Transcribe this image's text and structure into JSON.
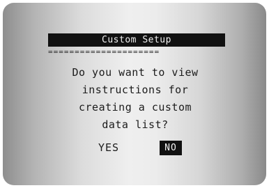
{
  "dialog": {
    "title": "Custom Setup",
    "divider": "=====================",
    "message_lines": [
      "Do you want to view",
      "instructions for",
      "creating a custom",
      "data list?"
    ]
  },
  "options": {
    "yes_label": "YES",
    "no_label": "NO",
    "selected": "NO"
  },
  "colors": {
    "highlight_bg": "#111111",
    "highlight_fg": "#f2f2f2",
    "text": "#1c1c1c"
  }
}
